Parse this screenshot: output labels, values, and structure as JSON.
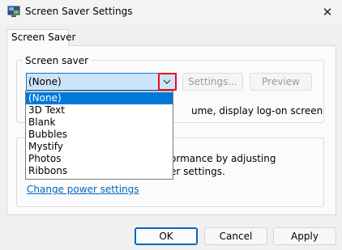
{
  "window": {
    "title": "Screen Saver Settings",
    "close_glyph": "✕"
  },
  "tabs": [
    {
      "label": "Screen Saver"
    }
  ],
  "screen_saver": {
    "group_title": "Screen saver",
    "selected": "(None)",
    "settings_label": "Settings...",
    "preview_label": "Preview",
    "wait_text_partial": "ume, display log-on screen",
    "options": [
      "(None)",
      "3D Text",
      "Blank",
      "Bubbles",
      "Mystify",
      "Photos",
      "Ribbons"
    ]
  },
  "power": {
    "text_line1_partial": "ormance by adjusting",
    "text_line2_partial": "er settings.",
    "link_label": "Change power settings"
  },
  "footer": {
    "ok_label": "OK",
    "cancel_label": "Cancel",
    "apply_label": "Apply"
  },
  "colors": {
    "accent": "#0078d7",
    "select_bg": "#cce4f7",
    "highlight_border": "#e81123",
    "link": "#0067c0"
  }
}
